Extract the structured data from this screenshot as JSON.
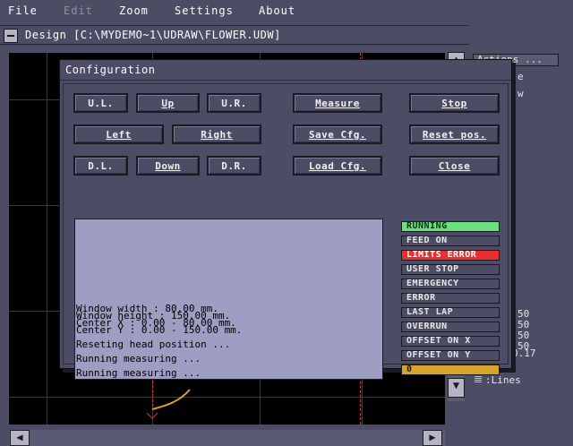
{
  "menu": {
    "file": "File",
    "edit": "Edit",
    "zoom": "Zoom",
    "settings": "Settings",
    "about": "About"
  },
  "design_window": {
    "title": "Design [C:\\MYDEMO~1\\UDRAW\\FLOWER.UDW]"
  },
  "right_panel": {
    "actions_button": "Actions ...",
    "partial_1": "e",
    "partial_2": "w",
    "values": [
      "50",
      "50",
      "50",
      "50"
    ],
    "last_value": "0.17",
    "lines_label": ":Lines"
  },
  "dialog": {
    "title": "Configuration",
    "buttons": {
      "ul": "U.L.",
      "up": "Up",
      "ur": "U.R.",
      "measure": "Measure",
      "stop": "Stop",
      "left": "Left",
      "right": "Right",
      "save_cfg": "Save Cfg.",
      "reset_pos": "Reset pos.",
      "dl": "D.L.",
      "down": "Down",
      "dr": "D.R.",
      "load_cfg": "Load Cfg.",
      "close": "Close"
    },
    "log_lines": [
      "Window width : 80.00 mm.",
      "Window height : 150.00 mm.",
      "Center X : 0.00 - 80.00 mm.",
      "Center Y : 0.00 - 150.00 mm.",
      "Reseting head position ...",
      "Running measuring ...",
      "Running measuring ..."
    ],
    "status": [
      {
        "label": "RUNNING",
        "state": "active-green"
      },
      {
        "label": "FEED ON",
        "state": "off"
      },
      {
        "label": "LIMITS ERROR",
        "state": "active-red"
      },
      {
        "label": "USER STOP",
        "state": "off"
      },
      {
        "label": "EMERGENCY",
        "state": "off"
      },
      {
        "label": "ERROR",
        "state": "off"
      },
      {
        "label": "LAST LAP",
        "state": "off"
      },
      {
        "label": "OVERRUN",
        "state": "off"
      },
      {
        "label": "OFFSET ON X",
        "state": "off"
      },
      {
        "label": "OFFSET ON Y",
        "state": "off"
      },
      {
        "label": "0",
        "state": "active-yellow"
      }
    ]
  },
  "colors": {
    "background": "#4c4c64",
    "log_background": "#9e9ec2",
    "running": "#6ce07c",
    "limits_error": "#e83030",
    "counter": "#d4a52a",
    "curve": "#d8a428",
    "guide": "#e03030"
  },
  "icons": {
    "system_menu": "minus-box-icon",
    "scroll_up": "up-arrow-icon",
    "scroll_down": "down-arrow-icon",
    "scroll_left": "left-arrow-icon",
    "scroll_right": "right-arrow-icon",
    "lines_legend": "grid-pattern-icon"
  }
}
